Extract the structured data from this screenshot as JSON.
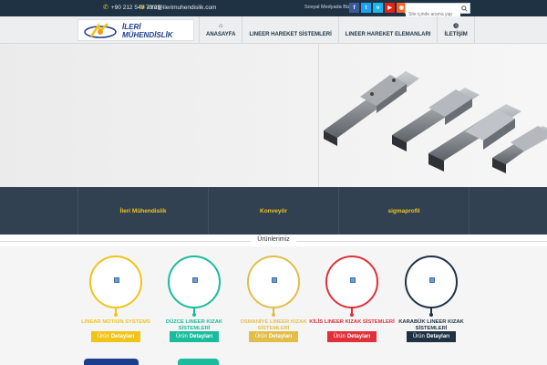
{
  "topbar": {
    "phone": "+90 212 549 70 25",
    "email": "info@ilerimuhendislik.com",
    "social_label": "Sosyal Medyada Biz",
    "social_icons": [
      "facebook-icon",
      "twitter-icon",
      "vimeo-icon",
      "youtube-icon",
      "rss-icon"
    ],
    "search_placeholder": "Site içinde arama yap"
  },
  "logo": {
    "line1": "İLERİ",
    "line2": "MÜHENDİSLİK"
  },
  "nav": [
    {
      "label": "ANASAYFA",
      "icon": "home-icon"
    },
    {
      "label": "LINEER HAREKET SİSTEMLERİ",
      "icon": ""
    },
    {
      "label": "LINEER HAREKET ELEMANLARI",
      "icon": ""
    },
    {
      "label": "İLETİŞİM",
      "icon": "globe-icon"
    }
  ],
  "band_tabs": [
    "İleri Mühendislik",
    "Konveyör",
    "sigmaprofil"
  ],
  "section_title": "Ürünlerimiz",
  "button_text": {
    "prefix": "Ürün",
    "suffix": "Detayları"
  },
  "products": [
    {
      "name": "LINEAR MOTION SYSTEMS",
      "color": "#f0c419"
    },
    {
      "name": "DÜZCE LINEER KIZAK SİSTEMLERİ",
      "color": "#1abc9c"
    },
    {
      "name": "OSMANİYE LINEER KIZAK SİSTEMLERİ",
      "color": "#e3bd4a"
    },
    {
      "name": "KİLİS LINEER KIZAK SİSTEMLERİ",
      "color": "#e0303a"
    },
    {
      "name": "KARABÜK LINEER KIZAK SİSTEMLERİ",
      "color": "#1f3244"
    }
  ],
  "colors": {
    "topbar": "#1f3244",
    "band": "#314152",
    "accent": "#f0c419"
  }
}
